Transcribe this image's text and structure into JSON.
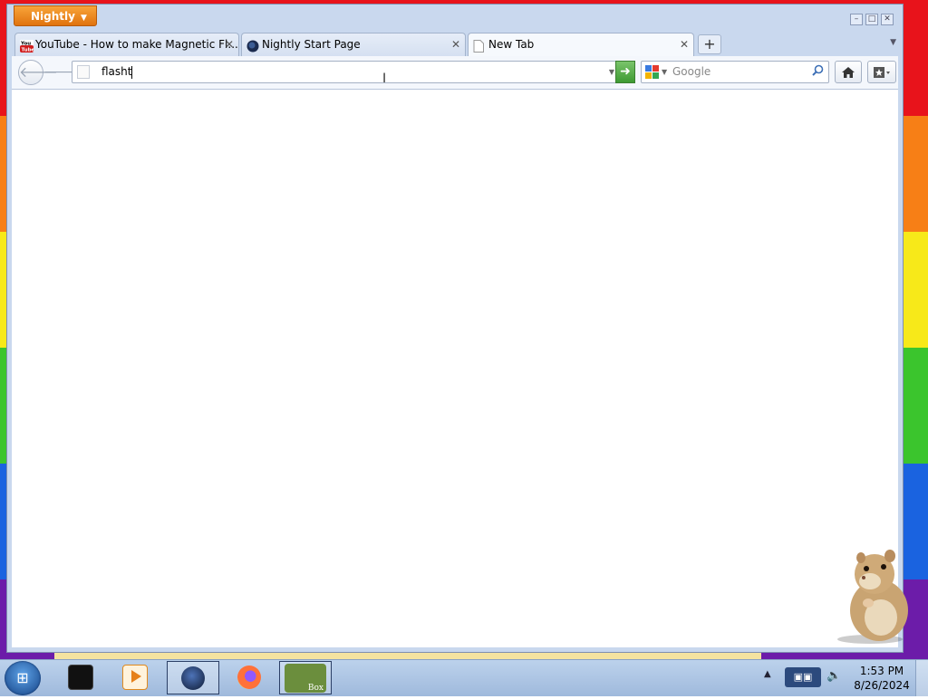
{
  "browser": {
    "app_menu_label": "Nightly",
    "tabs": [
      {
        "label": "YouTube - How to make Magnetic Fl...",
        "favicon": "youtube-icon",
        "active": false
      },
      {
        "label": "Nightly Start Page",
        "favicon": "nightly-globe-icon",
        "active": false
      },
      {
        "label": "New Tab",
        "favicon": "blank-page-icon",
        "active": true
      }
    ],
    "new_tab_symbol": "+",
    "url_value": "flasht",
    "search": {
      "engine": "Google",
      "placeholder": "Google"
    }
  },
  "taskbar": {
    "items": [
      {
        "name": "terminal-app-icon"
      },
      {
        "name": "media-player-icon"
      },
      {
        "name": "nightly-browser-icon"
      },
      {
        "name": "firefox-icon"
      },
      {
        "name": "hamster-box-icon",
        "label": "Box"
      }
    ],
    "clock_time": "1:53 PM",
    "clock_date": "8/26/2024"
  },
  "colors": {
    "nightly_orange": "#e0730e",
    "go_button_green": "#3e9a32"
  }
}
